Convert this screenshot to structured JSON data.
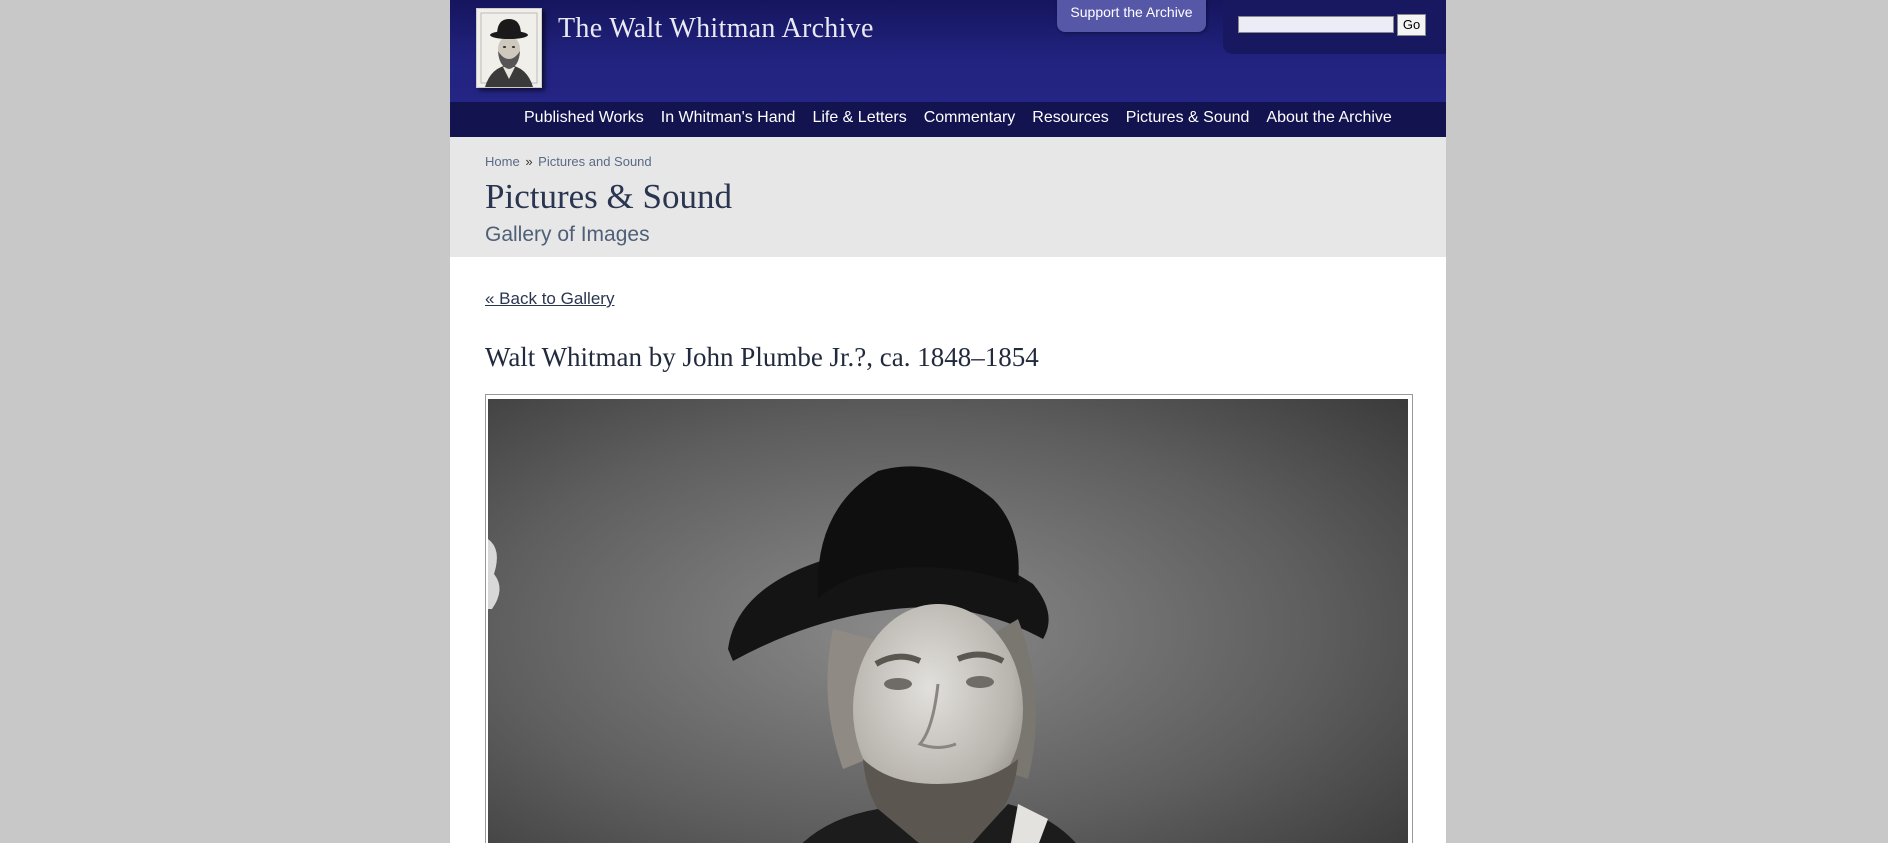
{
  "header": {
    "site_title": "The Walt Whitman Archive",
    "support_label": "Support the Archive",
    "search": {
      "value": "",
      "placeholder": "",
      "go_label": "Go"
    }
  },
  "nav": {
    "items": [
      {
        "label": "Published Works"
      },
      {
        "label": "In Whitman's Hand"
      },
      {
        "label": "Life & Letters"
      },
      {
        "label": "Commentary"
      },
      {
        "label": "Resources"
      },
      {
        "label": "Pictures & Sound"
      },
      {
        "label": "About the Archive"
      }
    ]
  },
  "breadcrumb": {
    "home": "Home",
    "separator": "»",
    "current": "Pictures and Sound"
  },
  "page": {
    "title": "Pictures & Sound",
    "subtitle": "Gallery of Images"
  },
  "content": {
    "back_link": "« Back to Gallery",
    "image_title": "Walt Whitman by John Plumbe Jr.?, ca. 1848–1854"
  },
  "colors": {
    "header_bg": "#222380",
    "nav_bg": "#131350",
    "support_tab": "#5757a8",
    "title_area_bg": "#e7e7e8",
    "page_bg": "#c8c8c8",
    "heading_text": "#2a3550"
  }
}
